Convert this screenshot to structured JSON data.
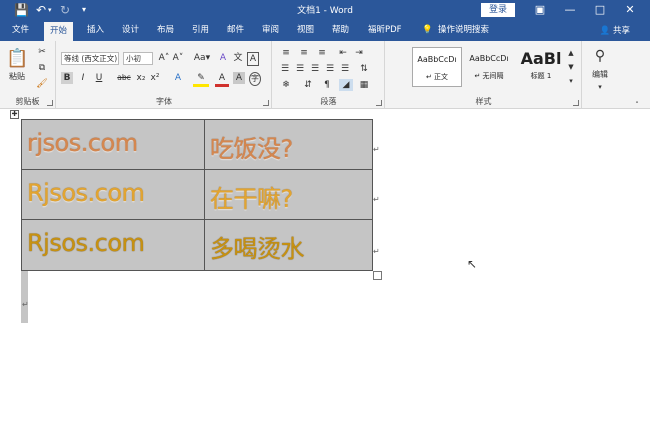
{
  "titlebar": {
    "title": "文档1 - Word",
    "login_label": "登录",
    "save_icon": "save-icon",
    "undo_icon": "undo-icon",
    "redo_icon": "redo-icon",
    "customize_icon": "customize-quick-access-icon"
  },
  "tabs": [
    {
      "label": "文件"
    },
    {
      "label": "开始",
      "active": true
    },
    {
      "label": "插入"
    },
    {
      "label": "设计"
    },
    {
      "label": "布局"
    },
    {
      "label": "引用"
    },
    {
      "label": "邮件"
    },
    {
      "label": "审阅"
    },
    {
      "label": "视图"
    },
    {
      "label": "帮助"
    },
    {
      "label": "福昕PDF"
    },
    {
      "label": "操作说明搜索"
    }
  ],
  "share_label": "共享",
  "ribbon": {
    "clipboard": {
      "paste_label": "粘贴",
      "group_label": "剪贴板"
    },
    "font": {
      "font_name": "等线 (西文正文)",
      "font_size": "小初",
      "bold": "B",
      "italic": "I",
      "underline": "U",
      "strike": "abc",
      "sub": "x₂",
      "sup": "x²",
      "group_label": "字体"
    },
    "paragraph": {
      "group_label": "段落"
    },
    "styles": {
      "items": [
        {
          "preview": "AaBbCcDı",
          "name": "↵ 正文"
        },
        {
          "preview": "AaBbCcDı",
          "name": "↵ 无间隔"
        },
        {
          "preview": "AaBl",
          "name": "标题 1"
        }
      ],
      "group_label": "样式"
    },
    "editing": {
      "label": "编辑"
    }
  },
  "table": {
    "rows": [
      {
        "left": "rjsos.com",
        "right": "吃饭没?"
      },
      {
        "left": "Rjsos.com",
        "right": "在干嘛?"
      },
      {
        "left": "Rjsos.com",
        "right": "多喝烫水"
      }
    ]
  }
}
